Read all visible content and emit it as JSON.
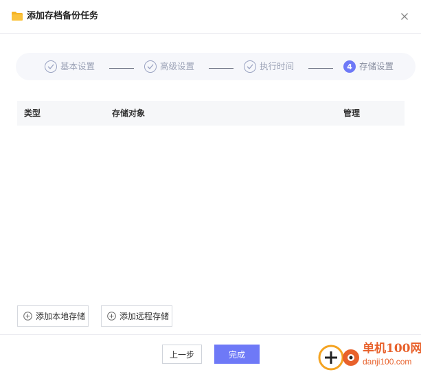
{
  "dialog": {
    "title": "添加存档备份任务",
    "icons": {
      "title": "folder-icon",
      "close": "close-icon"
    }
  },
  "steps": [
    {
      "number": "",
      "label": "基本设置",
      "state": "done",
      "icon": "check-icon"
    },
    {
      "number": "",
      "label": "高级设置",
      "state": "done",
      "icon": "check-icon"
    },
    {
      "number": "",
      "label": "执行时间",
      "state": "done",
      "icon": "check-icon"
    },
    {
      "number": "4",
      "label": "存储设置",
      "state": "active",
      "icon": ""
    }
  ],
  "table": {
    "columns": [
      "类型",
      "存储对象",
      "管理"
    ],
    "rows": []
  },
  "actions": {
    "add_local": "添加本地存储",
    "add_remote": "添加远程存储",
    "prev": "上一步",
    "finish": "完成"
  },
  "watermark": {
    "line1": "单机100网",
    "line2": "danji100.com"
  },
  "colors": {
    "accent": "#6e79f7",
    "step_bar_bg": "#f6f7fb",
    "folder": "#f5b324",
    "watermark": "#e8612b"
  }
}
